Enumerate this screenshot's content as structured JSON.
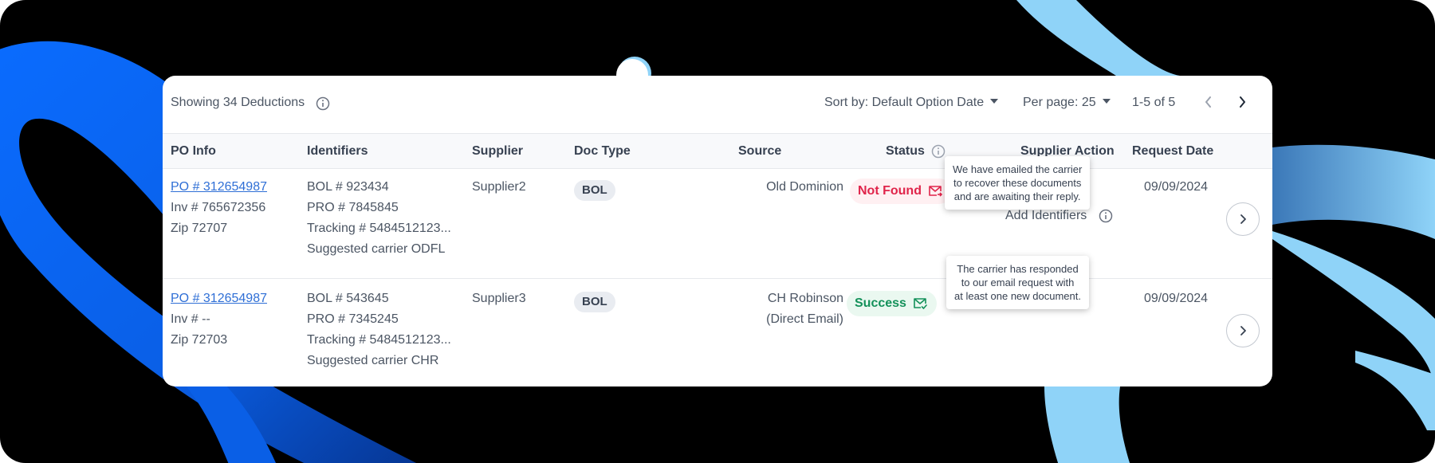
{
  "header": {
    "showing_label": "Showing 34 Deductions",
    "sort_label": "Sort by: Default Option Date",
    "per_page_label": "Per page: 25",
    "page_range": "1-5 of 5"
  },
  "columns": {
    "po_info": "PO Info",
    "identifiers": "Identifiers",
    "supplier": "Supplier",
    "doc_type": "Doc Type",
    "source": "Source",
    "status": "Status",
    "supplier_action": "Supplier Action",
    "request_date": "Request Date"
  },
  "rows": [
    {
      "po": "PO # 312654987",
      "inv": "Inv # 765672356",
      "zip": "Zip 72707",
      "bol": "BOL # 923434",
      "pro": "PRO # 7845845",
      "tracking": "Tracking # 5484512123...",
      "carrier": "Suggested carrier ODFL",
      "supplier": "Supplier2",
      "doc_type": "BOL",
      "source_line1": "Old Dominion",
      "source_line2": "",
      "status": "Not Found",
      "supplier_action": "Add Identifiers",
      "request_date": "09/09/2024"
    },
    {
      "po": "PO # 312654987",
      "inv": "Inv # --",
      "zip": "Zip 72703",
      "bol": "BOL # 543645",
      "pro": "PRO # 7345245",
      "tracking": "Tracking # 5484512123...",
      "carrier": "Suggested carrier CHR",
      "supplier": "Supplier3",
      "doc_type": "BOL",
      "source_line1": "CH Robinson",
      "source_line2": "(Direct Email)",
      "status": "Success",
      "supplier_action": "",
      "request_date": "09/09/2024"
    }
  ],
  "tooltips": {
    "not_found": [
      "We have emailed the carrier",
      "to recover these documents",
      "and are awaiting their reply."
    ],
    "success": [
      "The carrier has responded",
      "to our email request with",
      "at least one new document."
    ]
  },
  "colors": {
    "link": "#2f6fd6",
    "not_found": "#e0244a",
    "success": "#14915a",
    "ribbon_dark": "#0a6cff",
    "ribbon_light": "#8fd3f8"
  },
  "icons": {
    "info": "info-circle-icon",
    "sort_caret": "caret-down-icon",
    "prev": "chevron-left-icon",
    "next": "chevron-right-icon",
    "mail_out": "mail-forward-icon",
    "mail_check": "mail-check-icon",
    "row_open": "chevron-right-icon"
  }
}
